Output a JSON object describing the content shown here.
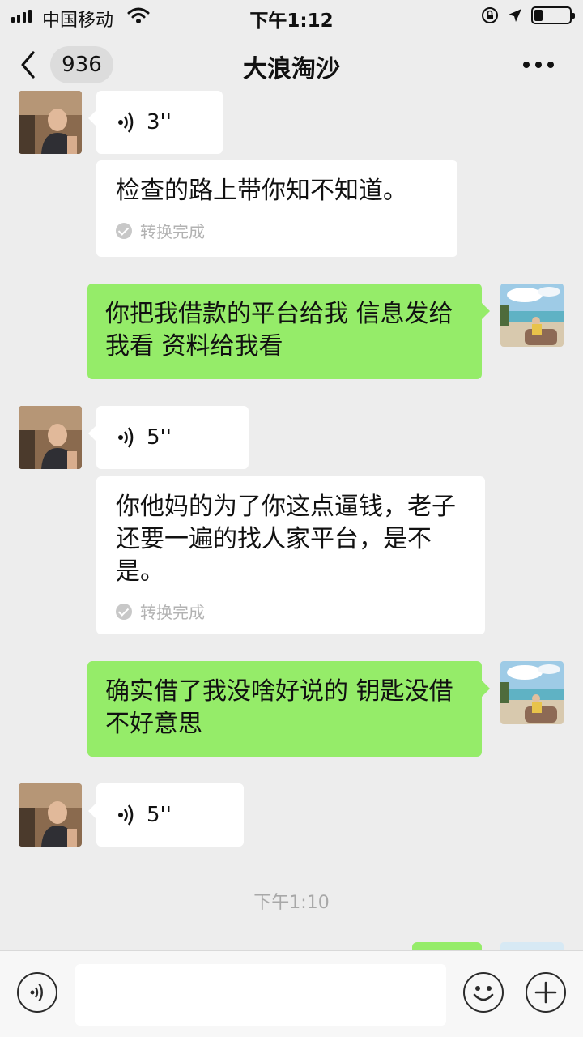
{
  "status_bar": {
    "carrier": "中国移动",
    "time": "下午1:12"
  },
  "nav": {
    "unread_count": "936",
    "title": "大浪淘沙"
  },
  "messages": [
    {
      "side": "left",
      "type": "voice",
      "duration": "3''"
    },
    {
      "side": "left",
      "type": "transcript",
      "text": "检查的路上带你知不知道。",
      "status": "转换完成"
    },
    {
      "side": "right",
      "type": "text",
      "text": "你把我借款的平台给我 信息发给我看 资料给我看"
    },
    {
      "side": "left",
      "type": "voice",
      "duration": "5''"
    },
    {
      "side": "left",
      "type": "transcript",
      "text": "你他妈的为了你这点逼钱，老子还要一遍的找人家平台，是不是。",
      "status": "转换完成"
    },
    {
      "side": "right",
      "type": "text",
      "text": "确实借了我没啥好说的 钥匙没借 不好意思"
    },
    {
      "side": "left",
      "type": "voice",
      "duration": "5''"
    }
  ],
  "timestamp": "下午1:10",
  "colors": {
    "sent_bubble": "#95ec69",
    "received_bubble": "#ffffff",
    "background": "#ededed"
  },
  "icons": [
    "back-arrow-icon",
    "more-icon",
    "voice-wave-icon",
    "voice-input-icon",
    "emoji-icon",
    "plus-icon",
    "check-icon"
  ]
}
